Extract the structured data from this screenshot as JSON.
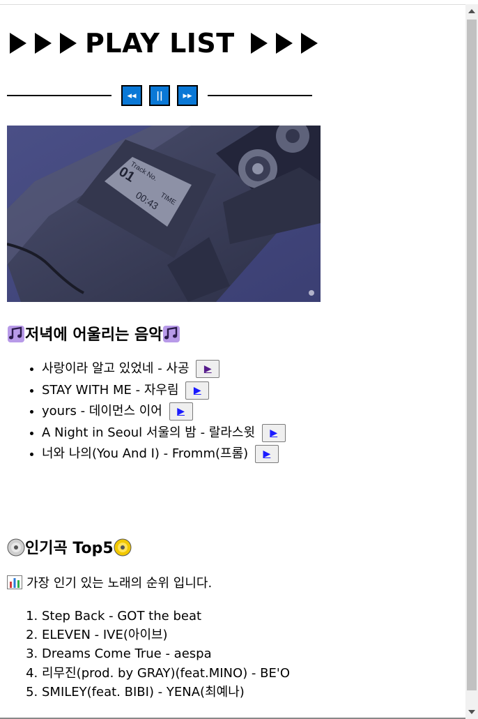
{
  "page": {
    "title": "PLAY LIST",
    "controls": {
      "rewind_glyph": "◂◂",
      "pause_glyph": "||",
      "forward_glyph": "▸▸"
    }
  },
  "section1": {
    "heading": "저녁에 어울리는 음악",
    "songs": [
      {
        "label": "사랑이라 알고 있었네 - 사공",
        "button": "▶"
      },
      {
        "label": "STAY WITH ME - 자우림",
        "button": "▶"
      },
      {
        "label": "yours - 데이먼스 이어",
        "button": "▶"
      },
      {
        "label": "A Night in Seoul 서울의 밤 - 랄라스윗",
        "button": "▶"
      },
      {
        "label": "너와 나의(You And I) - Fromm(프롬)",
        "button": "▶"
      }
    ]
  },
  "section2": {
    "heading": "인기곡 Top5",
    "description": "가장 인기 있는 노래의 순위 입니다.",
    "ranking": [
      "Step Back - GOT the beat",
      "ELEVEN - IVE(아이브)",
      "Dreams Come True - aespa",
      "리무진(prod. by GRAY)(feat.MINO) - BE'O",
      "SMILEY(feat. BIBI) - YENA(최예나)"
    ]
  },
  "image": {
    "track_label": "Track No.",
    "track_number": "01",
    "time_label": "TIME",
    "time_value": "00:43"
  },
  "colors": {
    "control_blue": "#0a78d6",
    "link": "#1a1aff",
    "visited_link": "#551a8b"
  }
}
